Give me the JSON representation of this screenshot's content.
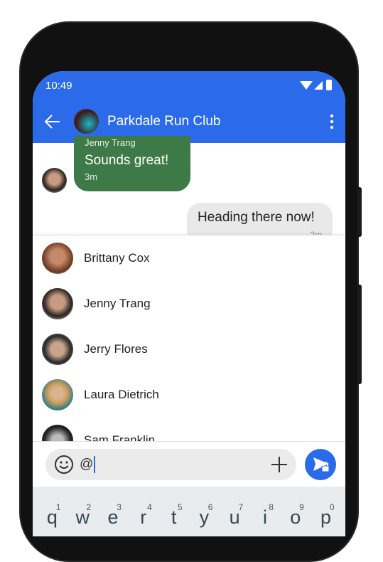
{
  "status_bar": {
    "time": "10:49"
  },
  "app_bar": {
    "title": "Parkdale Run Club",
    "back_icon": "arrow-left-icon",
    "menu_icon": "more-vert-icon"
  },
  "messages": [
    {
      "sender": "Jenny Trang",
      "text": "Sounds great!",
      "time": "3m",
      "direction": "incoming",
      "color": "#3d7a47"
    },
    {
      "text": "Heading there now!",
      "time": "2m",
      "direction": "outgoing"
    }
  ],
  "mentions": [
    {
      "name": "Brittany Cox"
    },
    {
      "name": "Jenny Trang"
    },
    {
      "name": "Jerry Flores"
    },
    {
      "name": "Laura Dietrich"
    },
    {
      "name": "Sam Franklin"
    }
  ],
  "composer": {
    "value": "@"
  },
  "keyboard": {
    "keys": [
      {
        "k": "q",
        "n": "1"
      },
      {
        "k": "w",
        "n": "2"
      },
      {
        "k": "e",
        "n": "3"
      },
      {
        "k": "r",
        "n": "4"
      },
      {
        "k": "t",
        "n": "5"
      },
      {
        "k": "y",
        "n": "6"
      },
      {
        "k": "u",
        "n": "7"
      },
      {
        "k": "i",
        "n": "8"
      },
      {
        "k": "o",
        "n": "9"
      },
      {
        "k": "p",
        "n": "0"
      }
    ]
  },
  "colors": {
    "primary": "#2b6bea",
    "incoming_bubble": "#3d7a47",
    "outgoing_bubble": "#e9e9e9"
  }
}
